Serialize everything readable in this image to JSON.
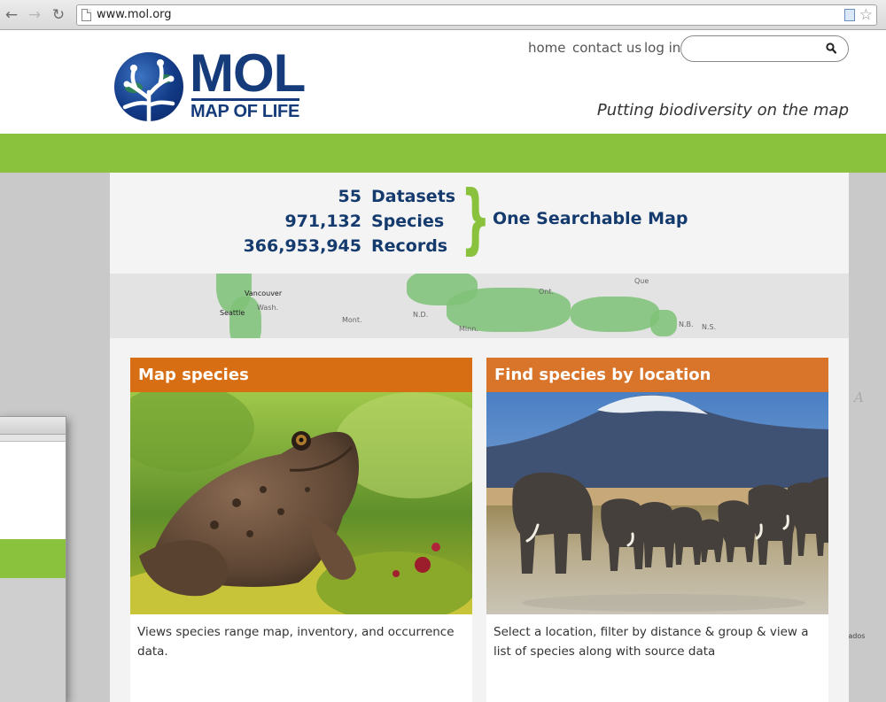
{
  "browser": {
    "url": "www.mol.org",
    "back_glyph": "←",
    "forward_glyph": "→",
    "reload_glyph": "↻",
    "star_glyph": "☆"
  },
  "header": {
    "logo_title": "MOL",
    "logo_subtitle": "MAP OF LIFE",
    "nav": {
      "home": "home",
      "contact": "contact us",
      "login": "log in"
    },
    "search": {
      "value": "",
      "placeholder": ""
    },
    "tagline": "Putting biodiversity on the map"
  },
  "stats": {
    "rows": [
      {
        "value": "55",
        "label": "Datasets"
      },
      {
        "value": "971,132",
        "label": "Species"
      },
      {
        "value": "366,953,945",
        "label": "Records"
      }
    ],
    "brace": "}",
    "slogan": "One Searchable Map"
  },
  "map_labels": {
    "vancouver": "Vancouver",
    "seattle": "Seattle",
    "wash": "Wash.",
    "mont": "Mont.",
    "nd": "N.D.",
    "minn": "Minn.",
    "ont": "Ont.",
    "que": "Que",
    "nb": "N.B.",
    "ns": "N.S.",
    "barbados": "rbados",
    "edge_letters": "A"
  },
  "cards": [
    {
      "title": "Map species",
      "description": "Views species range map, inventory, and occurrence data."
    },
    {
      "title": "Find species by location",
      "description": "Select a location, filter by distance & group & view a list of species along with source data"
    }
  ],
  "colors": {
    "brand_navy": "#153b7a",
    "brand_green": "#8ac23e",
    "card_orange": "#d86e14"
  }
}
